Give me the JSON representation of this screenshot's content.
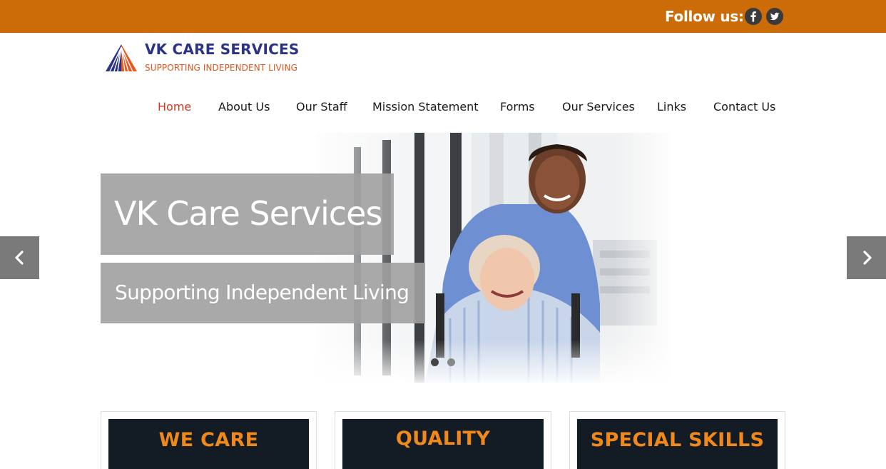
{
  "topbar": {
    "follow_label": "Follow us:",
    "social": [
      {
        "icon": "facebook-icon"
      },
      {
        "icon": "twitter-icon"
      }
    ],
    "color": "#cc6c08"
  },
  "brand": {
    "name": "VK CARE SERVICES",
    "tagline": "SUPPORTING INDEPENDENT LIVING",
    "name_color": "#2b3385",
    "tagline_color": "#e0561c"
  },
  "nav": {
    "items": [
      {
        "label": "Home",
        "active": true
      },
      {
        "label": "About Us"
      },
      {
        "label": "Our Staff"
      },
      {
        "label": "Mission Statement"
      },
      {
        "label": "Forms"
      },
      {
        "label": "Our Services"
      },
      {
        "label": "Links"
      },
      {
        "label": "Contact Us"
      }
    ],
    "active_color": "#d23a24"
  },
  "slider": {
    "title": "VK Care Services",
    "subtitle": "Supporting Independent Living",
    "slide_count": 2,
    "active_slide": 1,
    "prev_icon": "chevron-left-icon",
    "next_icon": "chevron-right-icon"
  },
  "features": [
    {
      "title": "WE CARE"
    },
    {
      "title": "QUALITY"
    },
    {
      "title": "SPECIAL SKILLS"
    }
  ],
  "colors": {
    "feature_text": "#f0891a",
    "feature_bg": "#131b24"
  }
}
